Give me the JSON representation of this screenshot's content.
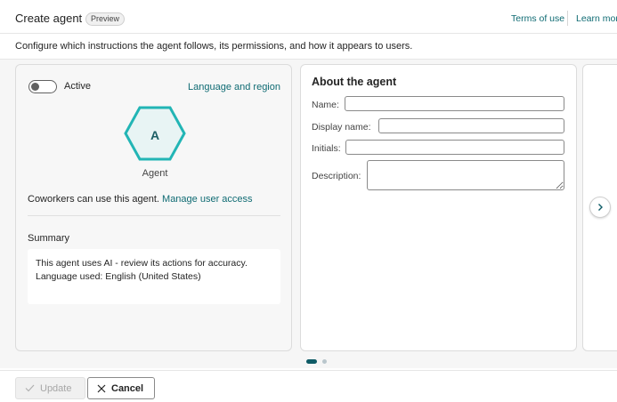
{
  "header": {
    "title": "Create agent",
    "badge": "Preview",
    "terms_link": "Terms of use",
    "learn_link": "Learn more"
  },
  "subtitle": "Configure which instructions the agent follows, its permissions, and how it appears to users.",
  "left_card": {
    "toggle_label": "Active",
    "toggle_on": false,
    "language_link": "Language and region",
    "avatar_initial": "A",
    "avatar_caption": "Agent",
    "access_text": "Coworkers can use this agent.",
    "access_link": "Manage user access",
    "summary_label": "Summary",
    "summary_lines": [
      "This agent uses AI - review its actions for accuracy.",
      "Language used: English (United States)"
    ]
  },
  "about": {
    "title": "About the agent",
    "fields": {
      "name_label": "Name:",
      "name_value": "",
      "display_label": "Display name:",
      "display_value": "",
      "initials_label": "Initials:",
      "initials_value": "",
      "description_label": "Description:",
      "description_value": ""
    }
  },
  "pager": {
    "current": 1,
    "total": 2
  },
  "footer": {
    "update_label": "Update",
    "cancel_label": "Cancel"
  },
  "colors": {
    "accent": "#0f6b73",
    "hex_border": "#22b5b5",
    "hex_fill": "#e8f4f4"
  }
}
